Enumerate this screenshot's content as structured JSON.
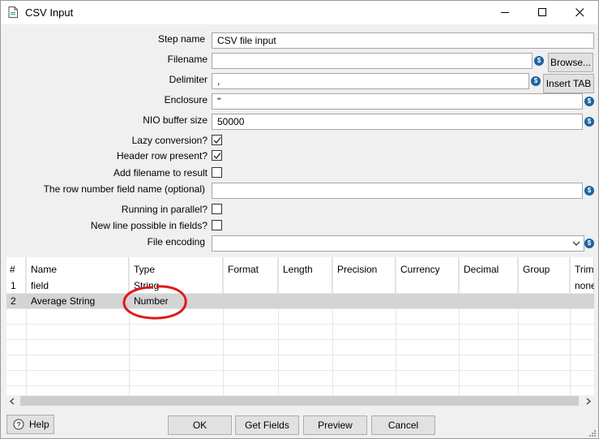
{
  "window": {
    "title": "CSV Input"
  },
  "form": {
    "step_name_label": "Step name",
    "step_name_value": "CSV file input",
    "filename_label": "Filename",
    "filename_value": "",
    "browse_label": "Browse...",
    "delimiter_label": "Delimiter",
    "delimiter_value": ",",
    "insert_tab_label": "Insert TAB",
    "enclosure_label": "Enclosure",
    "enclosure_value": "\"",
    "nio_label": "NIO buffer size",
    "nio_value": "50000",
    "lazy_label": "Lazy conversion?",
    "lazy_checked": true,
    "header_label": "Header row present?",
    "header_checked": true,
    "addfile_label": "Add filename to result",
    "addfile_checked": false,
    "rownum_label": "The row number field name (optional)",
    "rownum_value": "",
    "parallel_label": "Running in parallel?",
    "parallel_checked": false,
    "newline_label": "New line possible in fields?",
    "newline_checked": false,
    "encoding_label": "File encoding",
    "encoding_value": "",
    "variable_icon": "$"
  },
  "table": {
    "columns": [
      "#",
      "Name",
      "Type",
      "Format",
      "Length",
      "Precision",
      "Currency",
      "Decimal",
      "Group",
      "Trim"
    ],
    "rows": [
      [
        "1",
        "field",
        "String",
        "",
        "",
        "",
        "",
        "",
        "",
        "none"
      ],
      [
        "2",
        "Average String",
        "Number",
        "",
        "",
        "",
        "",
        "",
        "",
        ""
      ]
    ]
  },
  "buttons": {
    "help": "Help",
    "ok": "OK",
    "get_fields": "Get Fields",
    "preview": "Preview",
    "cancel": "Cancel"
  },
  "colors": {
    "annotation": "#e0181b",
    "selected_row": "#d4d4d4",
    "variable_icon": "#1c64a0"
  }
}
